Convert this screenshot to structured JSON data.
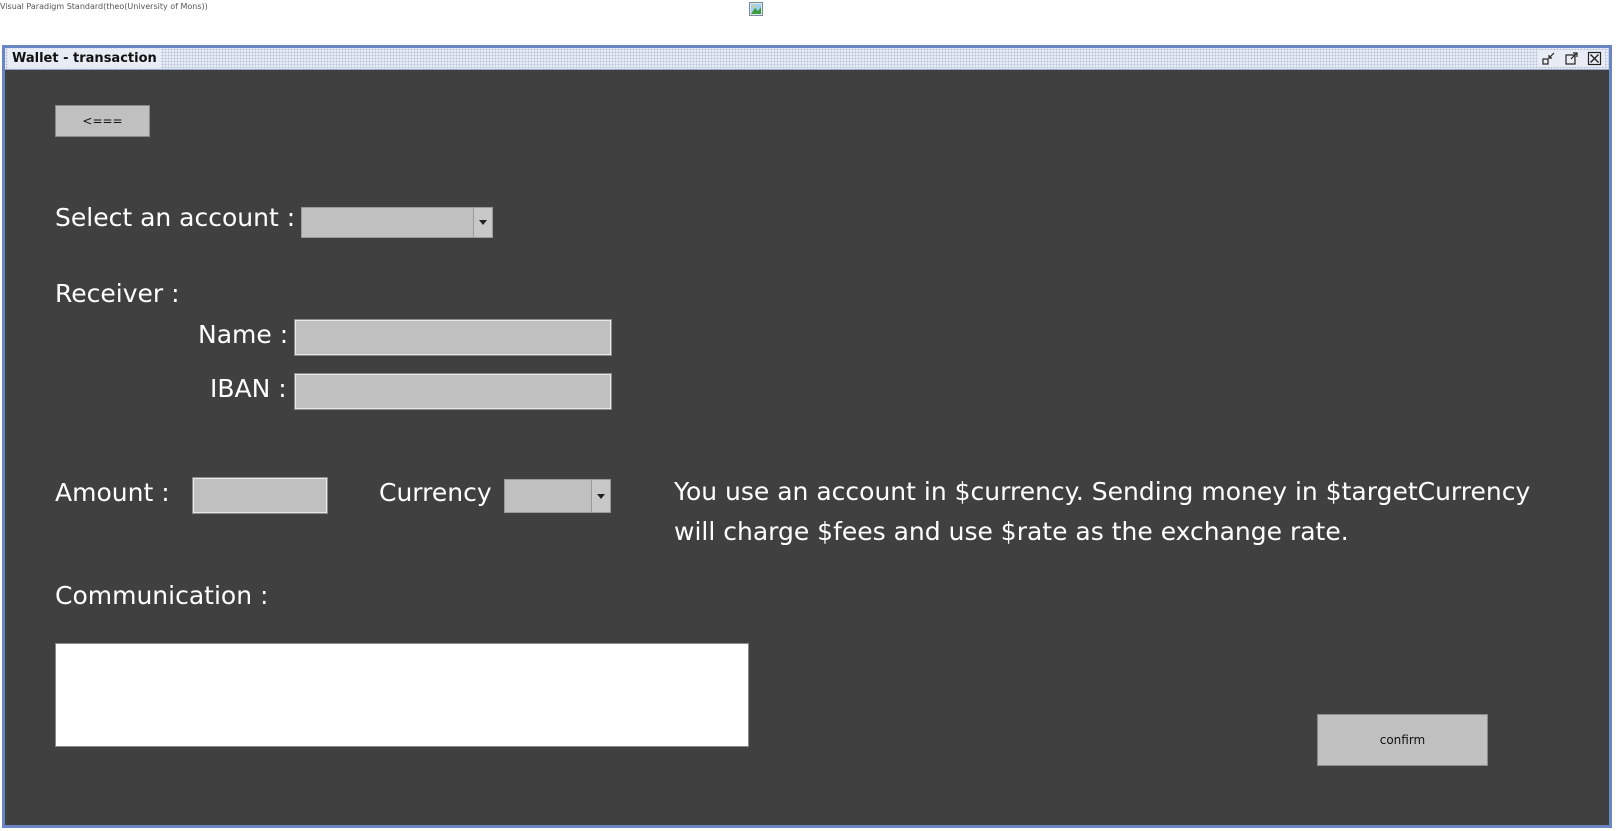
{
  "app": {
    "watermark": "Visual Paradigm Standard(theo(University of Mons))"
  },
  "window": {
    "title": "Wallet - transaction",
    "buttons": [
      "minimize-icon",
      "maximize-icon",
      "close-icon"
    ]
  },
  "form": {
    "back_label": "<===",
    "account_label": "Select an account :",
    "account_value": "",
    "receiver_label": "Receiver :",
    "name_label": "Name :",
    "name_value": "",
    "iban_label": "IBAN :",
    "iban_value": "",
    "amount_label": "Amount :",
    "amount_value": "",
    "currency_label": "Currency",
    "currency_value": "",
    "info_text": "You use an account in $currency. Sending money in $targetCurrency will charge $fees and use $rate as the exchange rate.",
    "communication_label": "Communication :",
    "communication_value": "",
    "confirm_label": "confirm"
  },
  "colors": {
    "window_bg": "#404040",
    "window_border": "#6a86c2",
    "control_bg": "#c0c0c0",
    "text": "#ffffff"
  }
}
